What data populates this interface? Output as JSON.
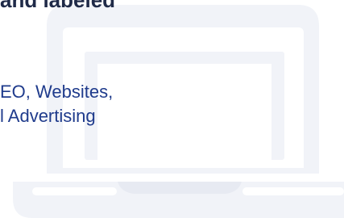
{
  "hero": {
    "headline_fragment": "and labeled",
    "services_line_1": "EO, Websites,",
    "services_line_2": "l Advertising"
  },
  "illustration": {
    "icon": "laptop-icon",
    "color": "#eef0f7"
  },
  "colors": {
    "headline": "#1f2a48",
    "services_text": "#1f3b8c",
    "background": "#ffffff"
  }
}
